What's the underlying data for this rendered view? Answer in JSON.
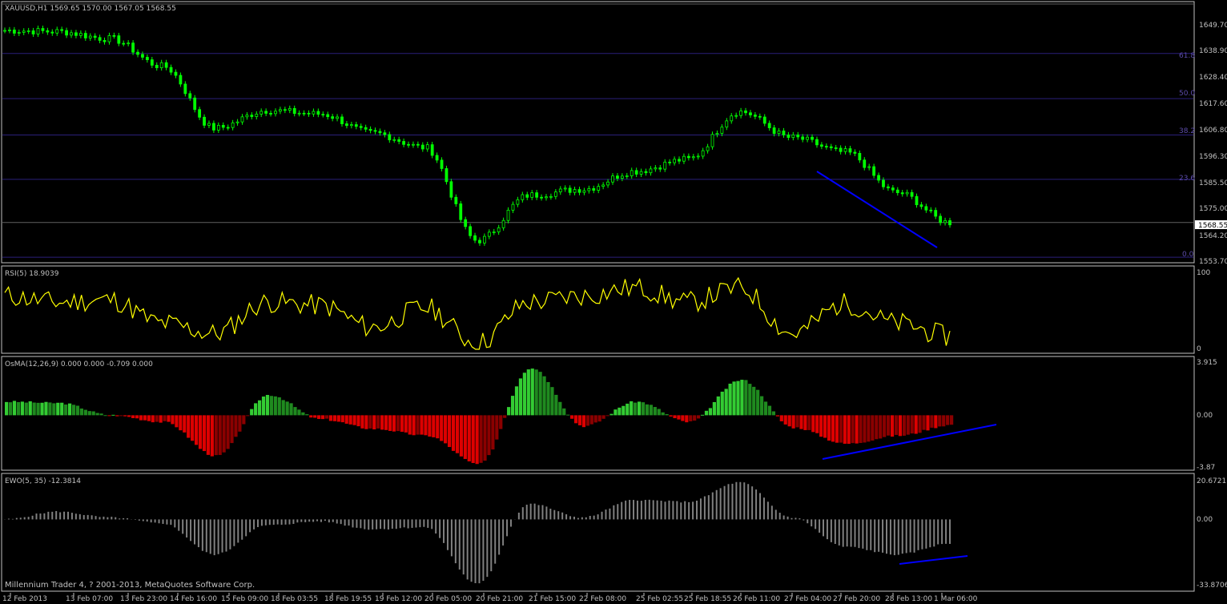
{
  "main": {
    "header": "XAUUSD,H1  1569.65 1570.00 1567.05 1568.55",
    "current_price_label": "1568.55",
    "y_ticks": [
      "1649.70",
      "1638.90",
      "1628.40",
      "1617.60",
      "1606.80",
      "1596.30",
      "1585.50",
      "1575.00",
      "1564.20",
      "1553.70"
    ],
    "fib_labels": [
      "61.8",
      "50.0",
      "38.2",
      "23.6",
      "0.0"
    ],
    "colors": {
      "bull_candle": "#00ff00",
      "fib_line": "#2a1f7a",
      "trend_line": "#0000ff"
    }
  },
  "rsi": {
    "header": "RSI(5) 18.9039",
    "y_ticks": [
      "100",
      "0"
    ],
    "color": "#ffff00"
  },
  "osma": {
    "header": "OsMA(12,26,9) 0.000 0.000 -0.709 0.000",
    "y_ticks": [
      "3.915",
      "0.00",
      "-3.87"
    ],
    "colors": {
      "positive": "#33cc33",
      "negative": "#dd0000"
    }
  },
  "ewo": {
    "header": "EWO(5, 35) -12.3814",
    "y_ticks": [
      "20.6721",
      "0.00",
      "-33.8706"
    ],
    "color": "#808080"
  },
  "x_labels": [
    "12 Feb 2013",
    "13 Feb 07:00",
    "13 Feb 23:00",
    "14 Feb 16:00",
    "15 Feb 09:00",
    "18 Feb 03:55",
    "18 Feb 19:55",
    "19 Feb 12:00",
    "20 Feb 05:00",
    "20 Feb 21:00",
    "21 Feb 15:00",
    "22 Feb 08:00",
    "25 Feb 02:55",
    "25 Feb 18:55",
    "26 Feb 11:00",
    "27 Feb 04:00",
    "27 Feb 20:00",
    "28 Feb 13:00",
    "1 Mar 06:00"
  ],
  "footer": "Millennium Trader 4, ? 2001-2013, MetaQuotes Software Corp.",
  "chart_data": {
    "type": "line",
    "title": "XAUUSD,H1",
    "x": [
      "12 Feb 2013",
      "13 Feb 07:00",
      "13 Feb 23:00",
      "14 Feb 16:00",
      "15 Feb 09:00",
      "18 Feb 03:55",
      "18 Feb 19:55",
      "19 Feb 12:00",
      "20 Feb 05:00",
      "20 Feb 21:00",
      "21 Feb 15:00",
      "22 Feb 08:00",
      "25 Feb 02:55",
      "25 Feb 18:55",
      "26 Feb 11:00",
      "27 Feb 04:00",
      "27 Feb 20:00",
      "28 Feb 13:00",
      "1 Mar 06:00"
    ],
    "series": [
      {
        "name": "XAUUSD,H1",
        "values": [
          1649.0,
          1648.5,
          1645.5,
          1634.0,
          1608.0,
          1615.5,
          1614.0,
          1606.0,
          1600.0,
          1561.0,
          1580.0,
          1582.5,
          1590.0,
          1595.0,
          1615.0,
          1604.0,
          1598.0,
          1581.0,
          1568.55
        ]
      },
      {
        "name": "RSI(5)",
        "values": [
          70,
          62,
          65,
          35,
          22,
          62,
          58,
          30,
          55,
          10,
          62,
          70,
          80,
          62,
          80,
          22,
          60,
          35,
          18.9
        ]
      },
      {
        "name": "OsMA(12,26,9)",
        "values": [
          1.0,
          0.9,
          0.0,
          -0.5,
          -3.0,
          1.5,
          -0.3,
          -1.0,
          -1.5,
          -3.6,
          3.5,
          -0.8,
          1.0,
          -0.5,
          2.6,
          -0.9,
          -2.1,
          -1.5,
          -0.709
        ]
      },
      {
        "name": "EWO(5, 35)",
        "values": [
          0,
          4,
          1,
          -2,
          -18,
          -3,
          -1,
          -5,
          -4,
          -33,
          8,
          1,
          10,
          9,
          19,
          1,
          -14,
          -18,
          -12.3814
        ]
      }
    ],
    "ylim_price": [
      1553.7,
      1655.0
    ],
    "ylim_rsi": [
      0,
      100
    ],
    "ylim_osma": [
      -3.87,
      3.915
    ],
    "ylim_ewo": [
      -33.8706,
      20.6721
    ],
    "fib_levels": {
      "61.8": 1639.3,
      "50.0": 1620.4,
      "38.2": 1605.2,
      "23.6": 1586.6,
      "0.0": 1554.0
    },
    "current_price": 1568.55,
    "annotations": [
      {
        "pane": "price",
        "type": "trend-line",
        "from": [
          "27 Feb 04:00",
          1588.0
        ],
        "to": [
          "1 Mar 06:00",
          1562.0
        ]
      },
      {
        "pane": "osma",
        "type": "trend-line",
        "from": [
          "27 Feb 20:00",
          -3.0
        ],
        "to": [
          "1 Mar 06:00",
          -0.6
        ]
      },
      {
        "pane": "ewo",
        "type": "trend-line",
        "from": [
          "28 Feb 13:00",
          -31.0
        ],
        "to": [
          "1 Mar 06:00",
          -28.0
        ]
      }
    ]
  }
}
